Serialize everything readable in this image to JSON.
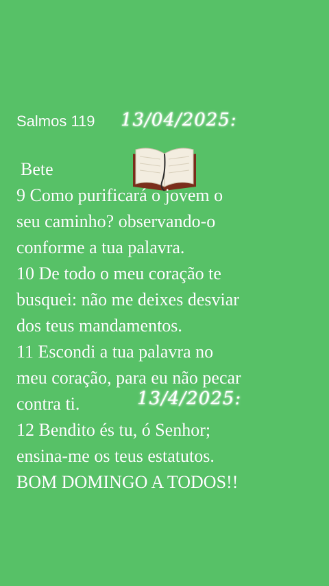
{
  "post": {
    "title": "Salmos 119",
    "date1": "13/04/2025:",
    "author": "Bete",
    "lines": [
      "9 Como purificará o jovem o",
      "seu caminho? observando-o",
      "conforme a tua palavra.",
      "10 De todo o meu coração te",
      "busquei: não me deixes desviar",
      "dos teus mandamentos.",
      "11 Escondi a tua palavra no",
      "meu coração, para eu não pecar",
      "contra ti.",
      "12 Bendito és tu, ó Senhor;",
      "ensina-me os teus estatutos.",
      "BOM DOMINGO A TODOS!!"
    ],
    "date2": "13/4/2025:"
  },
  "icons": {
    "book": "open-book-icon"
  },
  "colors": {
    "background": "#57c167",
    "text": "#ffffff"
  }
}
